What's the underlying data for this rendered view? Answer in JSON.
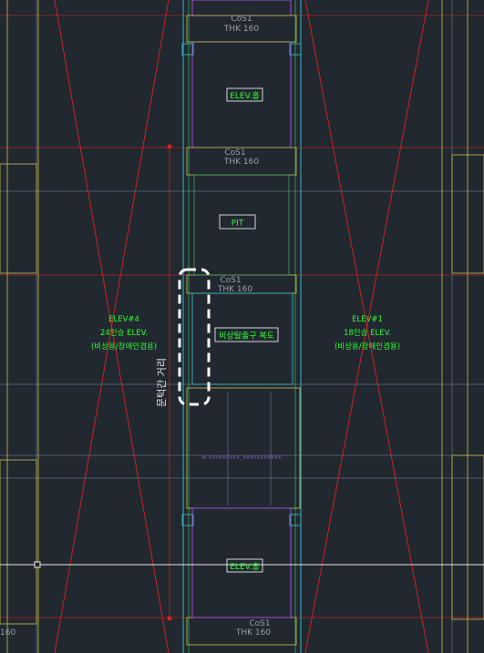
{
  "drawing": {
    "background": "#212830",
    "colors": {
      "grid_red": "#e0201e",
      "wall_yellow": "#b9b04a",
      "wall_cyan": "#35b6c2",
      "wall_purple": "#9e4fd0",
      "wall_green": "#3fa35a",
      "gray_line": "#5d6e82",
      "dim_white": "#e8e8e8",
      "label_green": "#2dff2d",
      "label_gray": "#9aa0a8",
      "highlight": "#ffffff"
    }
  },
  "labels": {
    "slab_top": "CoS1",
    "thk_top": "THK 160",
    "elev_hall_top": "ELEV.홀",
    "slab_mid1": "CoS1",
    "thk_mid1": "THK 160",
    "pit": "PIT",
    "slab_mid2": "CoS1",
    "thk_mid2": "THK 160",
    "corridor": "비상탈출구 복도",
    "elev4_name": "ELEV#4",
    "elev4_cap": "24인승 ELEV.",
    "elev4_type": "(비상용/장애인겸용)",
    "elev1_name": "ELEV#1",
    "elev1_cap": "18인승 ELEV.",
    "elev1_type": "(비상용/장애인겸용)",
    "vertical_note": "문턱간 거리",
    "center_note": "B-xxxxxxxxx_xxxxxxxxxxx",
    "elev_hall_bottom": "ELEV.홀",
    "slab_bottom": "CoS1",
    "thk_bottom": "THK 160",
    "left_edge_num": "160"
  }
}
